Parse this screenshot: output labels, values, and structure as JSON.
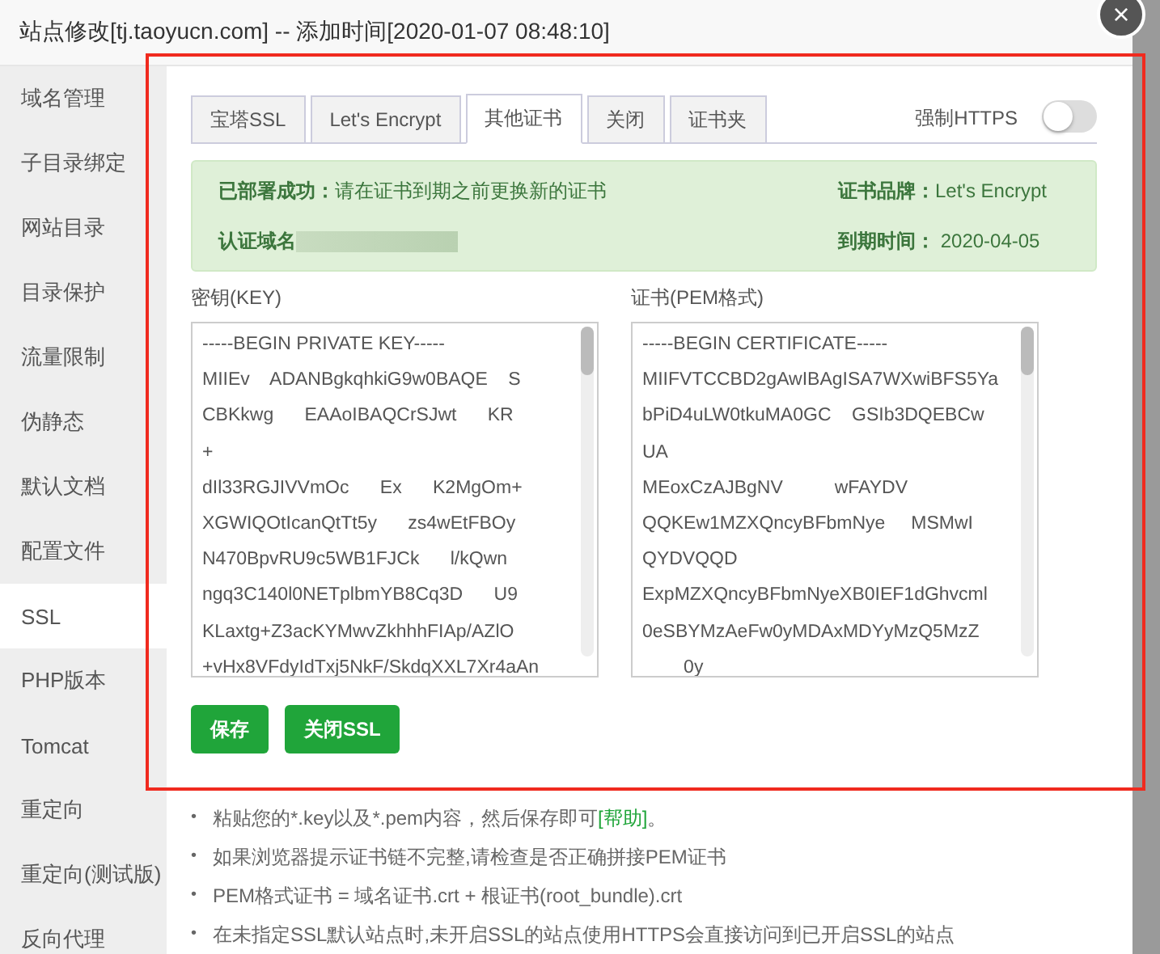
{
  "window": {
    "title": "站点修改[tj.taoyucn.com] -- 添加时间[2020-01-07 08:48:10]",
    "close": "×"
  },
  "sidebar": {
    "items": [
      {
        "label": "域名管理",
        "selected": false
      },
      {
        "label": "子目录绑定",
        "selected": false
      },
      {
        "label": "网站目录",
        "selected": false
      },
      {
        "label": "目录保护",
        "selected": false
      },
      {
        "label": "流量限制",
        "selected": false
      },
      {
        "label": "伪静态",
        "selected": false
      },
      {
        "label": "默认文档",
        "selected": false
      },
      {
        "label": "配置文件",
        "selected": false
      },
      {
        "label": "SSL",
        "selected": true
      },
      {
        "label": "PHP版本",
        "selected": false
      },
      {
        "label": "Tomcat",
        "selected": false
      },
      {
        "label": "重定向",
        "selected": false
      },
      {
        "label": "重定向(测试版)",
        "selected": false
      },
      {
        "label": "反向代理",
        "selected": false
      }
    ]
  },
  "tabs": [
    {
      "label": "宝塔SSL",
      "selected": false
    },
    {
      "label": "Let's Encrypt",
      "selected": false
    },
    {
      "label": "其他证书",
      "selected": true
    },
    {
      "label": "关闭",
      "selected": false
    },
    {
      "label": "证书夹",
      "selected": false
    }
  ],
  "force_https": {
    "label": "强制HTTPS",
    "on": false
  },
  "status": {
    "deployed_label": "已部署成功：",
    "deployed_text": "请在证书到期之前更换新的证书",
    "domain_label": "认证域名",
    "brand_label": "证书品牌：",
    "brand_value": "Let's Encrypt",
    "expiry_label": "到期时间：",
    "expiry_value": "2020-04-05"
  },
  "key": {
    "label": "密钥(KEY)",
    "lines": [
      "-----BEGIN PRIVATE KEY-----",
      "MIIEv    ADANBgkqhkiG9w0BAQE    S",
      "CBKkwg      EAAoIBAQCrSJwt      KR",
      "+",
      "dIl33RGJIVVmOc      Ex      K2MgOm+",
      "XGWIQOtIcanQtTt5y      zs4wEtFBOy",
      "N470BpvRU9c5WB1FJCk      l/kQwn",
      "ngq3C140l0NETplbmYB8Cq3D      U9",
      "KLaxtg+Z3acKYMwvZkhhhFIAp/AZlO",
      "+vHx8VFdyIdTxj5NkF/SkdqXXL7Xr4aAn"
    ]
  },
  "cert": {
    "label": "证书(PEM格式)",
    "lines": [
      "-----BEGIN CERTIFICATE-----",
      "MIIFVTCCBD2gAwIBAgISA7WXwiBFS5Ya",
      "bPiD4uLW0tkuMA0GC    GSIb3DQEBCw",
      "UA",
      "MEoxCzAJBgNV          wFAYDV",
      "QQKEw1MZXQncyBFbmNye     MSMwI",
      "QYDVQQD",
      "ExpMZXQncyBFbmNyeXB0IEF1dGhvcml",
      "0eSBYMzAeFw0yMDAxMDYyMzQ5MzZ",
      "        0y"
    ]
  },
  "buttons": [
    "保存",
    "关闭SSL"
  ],
  "notes": [
    {
      "marker": "•",
      "text": "粘贴您的*.key以及*.pem内容，然后保存即可",
      "link": "[帮助]",
      "after": "。"
    },
    {
      "marker": "•",
      "text": "如果浏览器提示证书链不完整,请检查是否正确拼接PEM证书"
    },
    {
      "marker": "•",
      "text": "PEM格式证书 = 域名证书.crt + 根证书(root_bundle).crt"
    },
    {
      "marker": "•",
      "text": "在未指定SSL默认站点时,未开启SSL的站点使用HTTPS会直接访问到已开启SSL的站点"
    }
  ]
}
